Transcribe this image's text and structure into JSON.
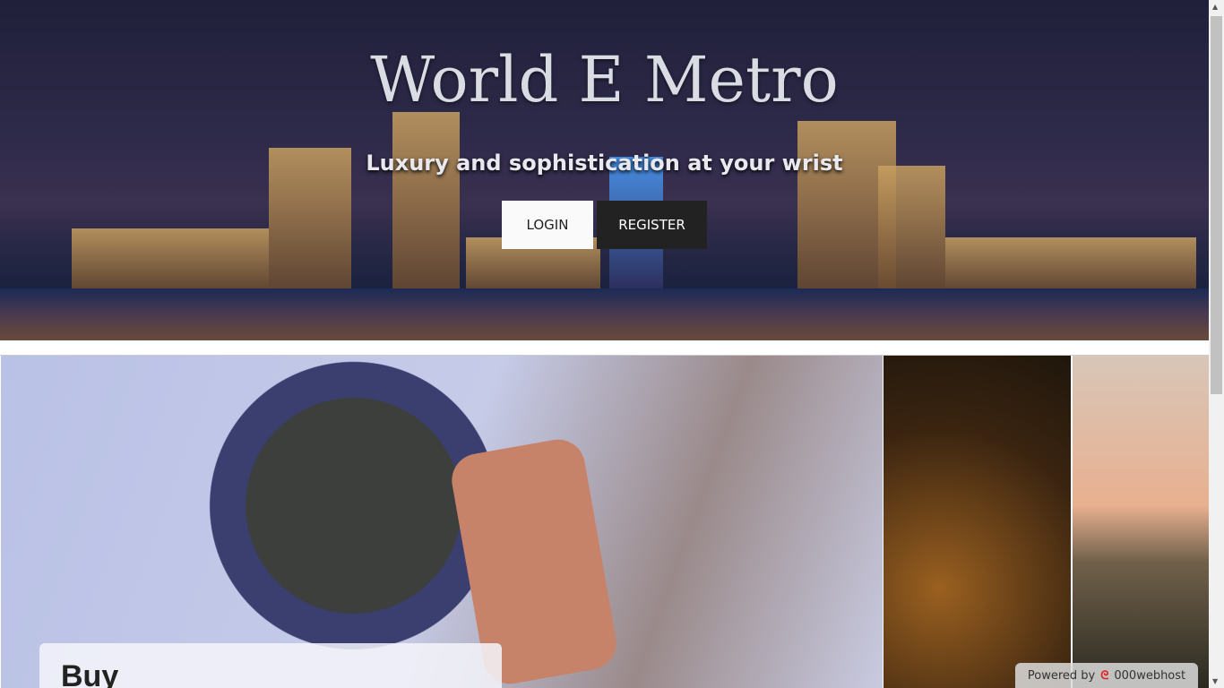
{
  "hero": {
    "title": "World E Metro",
    "tagline": "Luxury and sophistication at your wrist",
    "login_label": "LOGIN",
    "register_label": "REGISTER"
  },
  "gallery": {
    "card_title": "Buy"
  },
  "footer_badge": {
    "powered_by": "Powered by",
    "brand": "000webhost",
    "logo_icon": "000webhost-logo"
  }
}
